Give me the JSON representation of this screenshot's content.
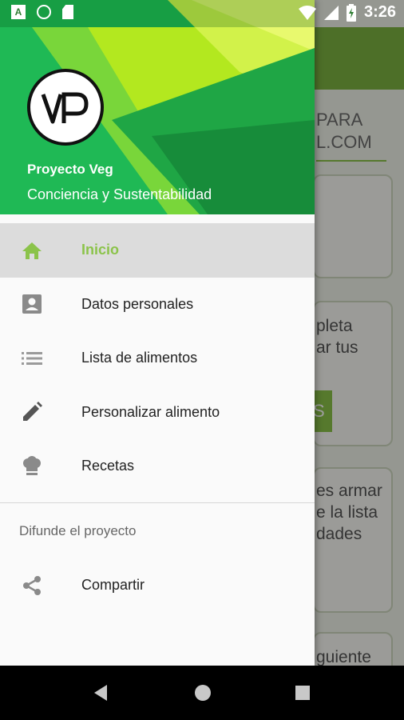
{
  "status_bar": {
    "time": "3:26",
    "notif_letter": "A"
  },
  "drawer": {
    "header": {
      "title": "Proyecto Veg",
      "subtitle": "Conciencia y Sustentabilidad"
    },
    "menu": [
      {
        "label": "Inicio",
        "icon": "home-icon",
        "selected": true
      },
      {
        "label": "Datos personales",
        "icon": "account-box-icon",
        "selected": false
      },
      {
        "label": "Lista de alimentos",
        "icon": "list-icon",
        "selected": false
      },
      {
        "label": "Personalizar alimento",
        "icon": "pencil-icon",
        "selected": false
      },
      {
        "label": "Recetas",
        "icon": "chef-hat-icon",
        "selected": false
      }
    ],
    "section_title": "Difunde el proyecto",
    "share": {
      "label": "Compartir",
      "icon": "share-icon"
    }
  },
  "background": {
    "heading_line1": "PARA",
    "heading_line2": "L.COM",
    "card2_line1": "pleta",
    "card2_line2": "ar tus",
    "button_text": "S",
    "card3_line1": "es armar",
    "card3_line2": "e la lista",
    "card3_line3": "dades",
    "card4_line1": "guiente"
  },
  "colors": {
    "accent": "#8bc34a",
    "header_green": "#27c05a",
    "lime": "#c6ef2a"
  }
}
